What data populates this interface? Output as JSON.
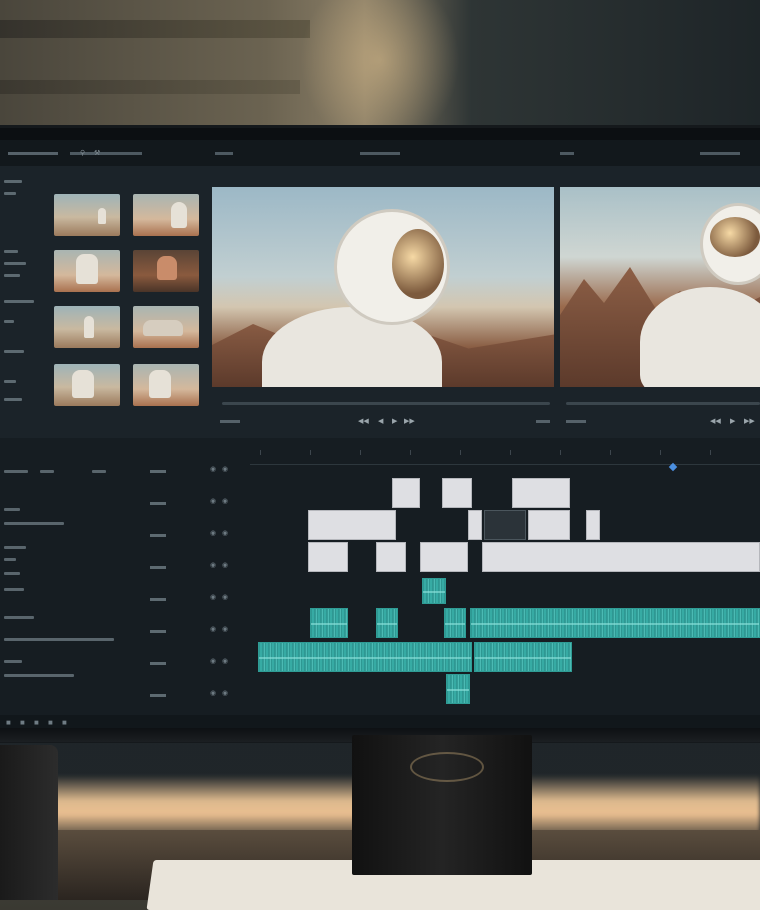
{
  "scene": {
    "wall_colors": {
      "accent": "#8a7e66",
      "dark": "#1e2528"
    },
    "desk_light_color": "#ffd4a0"
  },
  "editor": {
    "accent_timeline_blue": "#4b8fe0",
    "audio_clip_color": "#3bb4ad",
    "video_clip_color": "#dedfe3"
  },
  "icons": {
    "search": "search-icon",
    "wrench": "wrench-icon",
    "playhead": "playhead-icon",
    "transport": [
      "step-back-icon",
      "play-back-icon",
      "play-icon",
      "play-forward-icon",
      "step-forward-icon"
    ]
  }
}
